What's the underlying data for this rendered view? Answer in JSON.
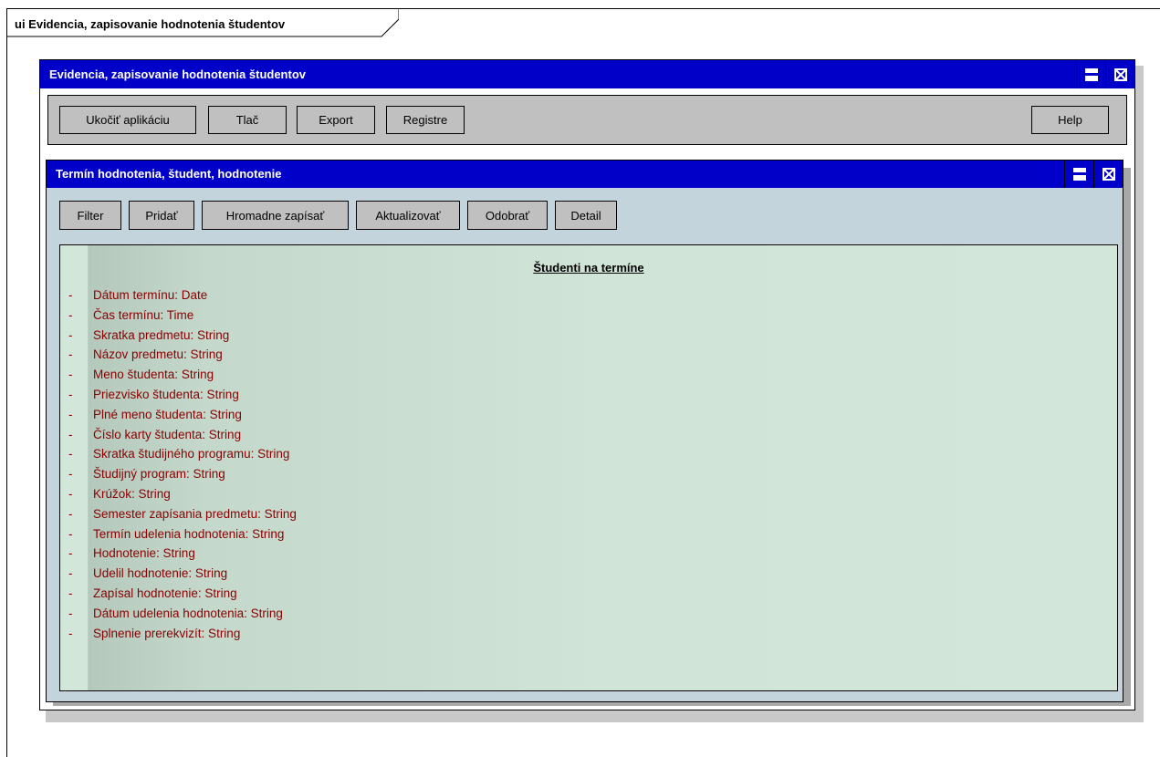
{
  "frame": {
    "title": "ui Evidencia, zapisovanie hodnotenia študentov"
  },
  "main_window": {
    "title": "Evidencia, zapisovanie hodnotenia študentov",
    "toolbar": {
      "buttons": [
        "Ukočiť aplikáciu",
        "Tlač",
        "Export",
        "Registre"
      ],
      "help": "Help"
    }
  },
  "inner_window": {
    "title": "Termín hodnotenia, študent, hodnotenie",
    "buttons": [
      "Filter",
      "Pridať",
      "Hromadne zapísať",
      "Aktualizovať",
      "Odobrať",
      "Detail"
    ],
    "panel": {
      "heading": "Študenti na termíne",
      "dash": "-",
      "attributes": [
        "Dátum termínu: Date",
        "Čas termínu: Time",
        "Skratka predmetu: String",
        "Názov predmetu: String",
        "Meno študenta: String",
        "Priezvisko študenta: String",
        "Plné meno študenta: String",
        "Číslo karty študenta: String",
        "Skratka študijného programu: String",
        "Študijný program: String",
        "Krúžok: String",
        "Semester zapísania predmetu: String",
        "Termín udelenia hodnotenia: String",
        "Hodnotenie: String",
        "Udelil hodnotenie: String",
        "Zapísal hodnotenie: String",
        "Dátum udelenia hodnotenia: String",
        "Splnenie prerekvizít: String"
      ]
    }
  },
  "colors": {
    "titlebar": "#0000c8",
    "toolbar": "#c0c0c0",
    "inner_background": "#c4d4dc",
    "attribute_text": "#8b0000"
  },
  "icons": [
    "maximize-icon",
    "close-icon"
  ]
}
